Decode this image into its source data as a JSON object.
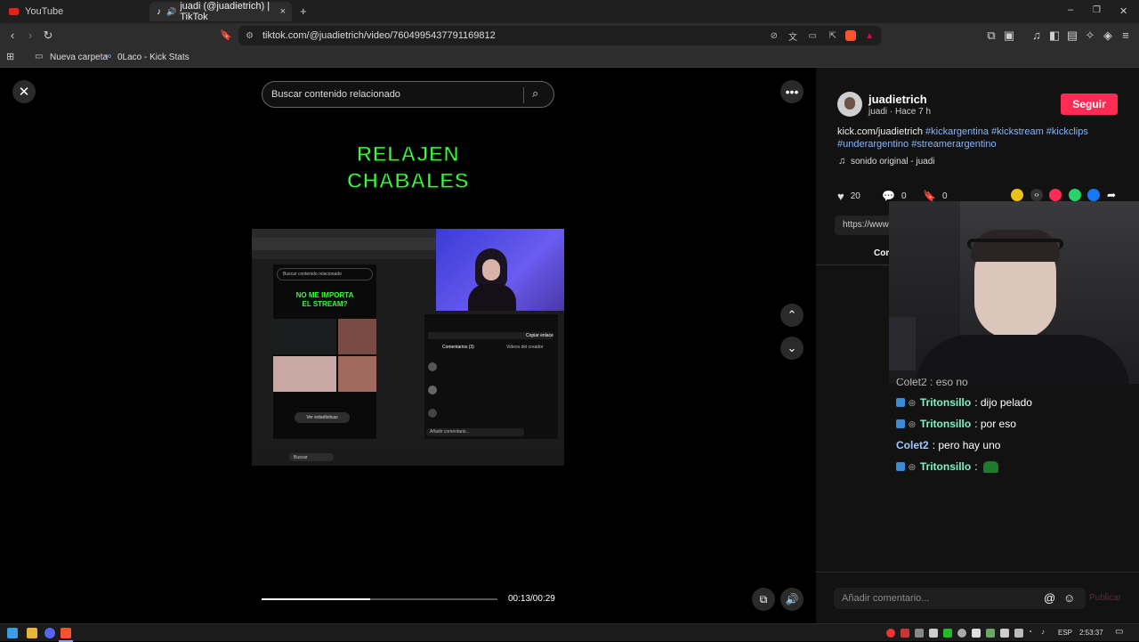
{
  "browser": {
    "tabs": [
      {
        "label": "YouTube"
      },
      {
        "label": "juadi (@juadietrich) | TikTok",
        "close": "×"
      }
    ],
    "new_tab": "+",
    "url": "tiktok.com/@juadietrich/video/7604995437791169812",
    "bookmarks": [
      "Nueva carpeta",
      "0Laco - Kick Stats"
    ],
    "window_controls": {
      "minimize": "–",
      "restore": "❐",
      "close": "✕"
    }
  },
  "video": {
    "close_icon": "close-icon",
    "search_placeholder": "Buscar contenido relacionado",
    "title_line1": "RELAJEN",
    "title_line2": "CHABALES",
    "inner": {
      "title1": "NO ME IMPORTA",
      "title2": "EL STREAM?",
      "search": "Buscar contenido relacionado",
      "stats_button": "Ver estadísticas",
      "comments_tab": "Comentarios (3)",
      "creator_videos_tab": "Videos del creador",
      "copy_link": "Copiar enlace",
      "add_comment": "Añadir comentario...",
      "taskbar_search": "Buscar"
    },
    "progress": 0.46,
    "time": "00:13/00:29"
  },
  "author": {
    "username": "juadietrich",
    "subtitle": "juadi · Hace 7 h",
    "follow": "Seguir",
    "desc_text": "kick.com/juadietrich",
    "hashtags": [
      "#kickargentina",
      "#kickstream",
      "#kickclips",
      "#underargentino",
      "#streamerargentino"
    ],
    "sound": "sonido original - juadi",
    "likes": "20",
    "comments": "0",
    "saves": "0",
    "link_prefix": "https://www",
    "tab_prefix": "Com"
  },
  "chat": {
    "partial": "Colet2 : eso no",
    "lines": [
      {
        "user": "Tritonsillo",
        "text": ": dijo pelado",
        "badge": true
      },
      {
        "user": "Tritonsillo",
        "text": ": por eso",
        "badge": true
      },
      {
        "user": "Colet2",
        "text": ": pero hay uno",
        "badge": false
      },
      {
        "user": "Tritonsillo",
        "text": ":",
        "badge": true
      }
    ]
  },
  "comment": {
    "placeholder": "Añadir comentario...",
    "publish": "Publicar"
  },
  "taskbar": {
    "lang": "ESP",
    "time": "2:53:37"
  },
  "colors": {
    "accent": "#fe2c55",
    "green_title": "#33ff33",
    "hashtag": "#8ab4f8"
  }
}
